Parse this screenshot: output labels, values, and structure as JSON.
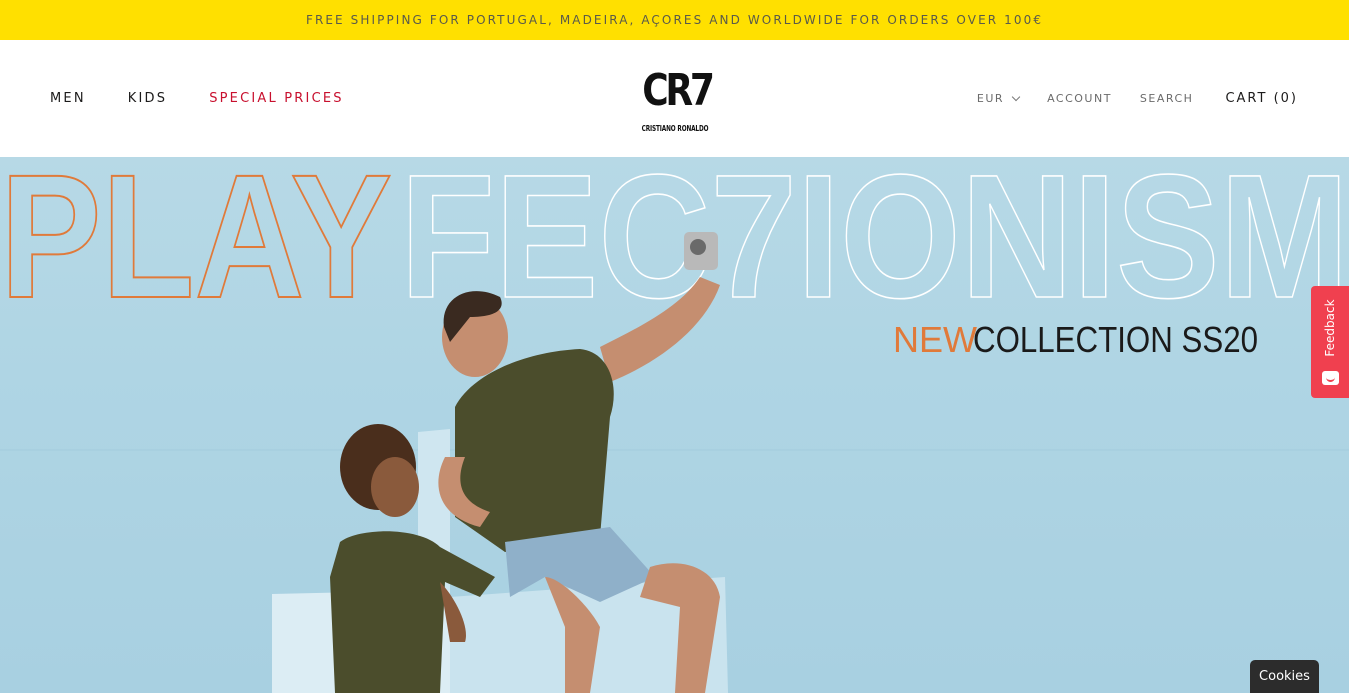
{
  "announcement": {
    "text": "FREE SHIPPING FOR PORTUGAL, MADEIRA, AÇORES AND WORLDWIDE FOR ORDERS OVER 100€"
  },
  "nav": {
    "men": "MEN",
    "kids": "KIDS",
    "special": "SPECIAL PRICES"
  },
  "logo": {
    "big": "CR7",
    "small": "CRISTIANO RONALDO"
  },
  "utility": {
    "currency": "EUR",
    "account": "ACCOUNT",
    "search": "SEARCH",
    "cart_label": "CART",
    "cart_count": "(0)"
  },
  "hero": {
    "word_orange": "PLAY",
    "word_white": "FEC7IONISM",
    "tagline_accent": "NEW",
    "tagline_rest": "COLLECTION SS20"
  },
  "widgets": {
    "feedback": "Feedback",
    "cookies": "Cookies"
  },
  "colors": {
    "announcement_bg": "#ffe000",
    "special_prices": "#c8102e",
    "accent_orange": "#e07a3a",
    "feedback_bg": "#f0404f"
  }
}
